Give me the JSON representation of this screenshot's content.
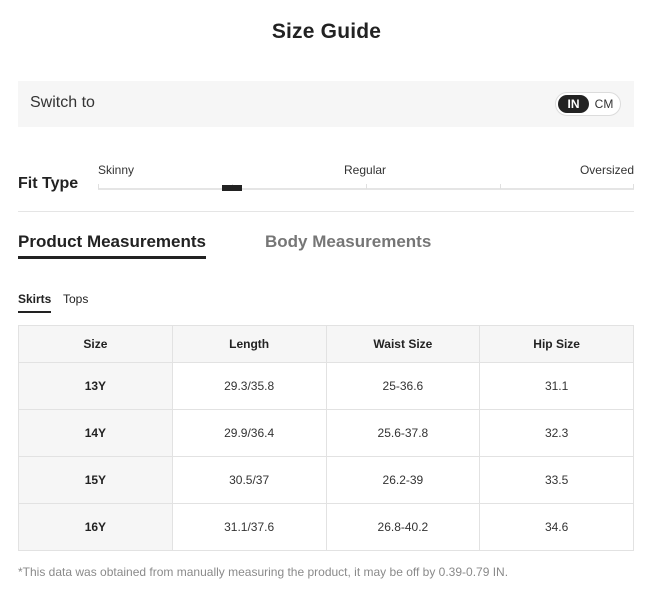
{
  "title": "Size Guide",
  "unit_switch": {
    "label": "Switch to",
    "options": [
      "IN",
      "CM"
    ],
    "selected": "IN"
  },
  "fit_type": {
    "label": "Fit Type",
    "scale_labels": [
      "Skinny",
      "Regular",
      "Oversized"
    ],
    "marker_level": 0.25
  },
  "tabs": {
    "active": "Product Measurements",
    "inactive": "Body Measurements"
  },
  "subtabs": {
    "active": "Skirts",
    "inactive": "Tops"
  },
  "table": {
    "headers": [
      "Size",
      "Length",
      "Waist Size",
      "Hip Size"
    ],
    "rows": [
      [
        "13Y",
        "29.3/35.8",
        "25-36.6",
        "31.1"
      ],
      [
        "14Y",
        "29.9/36.4",
        "25.6-37.8",
        "32.3"
      ],
      [
        "15Y",
        "30.5/37",
        "26.2-39",
        "33.5"
      ],
      [
        "16Y",
        "31.1/37.6",
        "26.8-40.2",
        "34.6"
      ]
    ]
  },
  "footnote": "*This data was obtained from manually measuring the product, it may be off by 0.39-0.79 IN.",
  "colors": {
    "accent": "#222222",
    "panel_bg": "#f6f6f6",
    "muted_text": "#767676"
  }
}
